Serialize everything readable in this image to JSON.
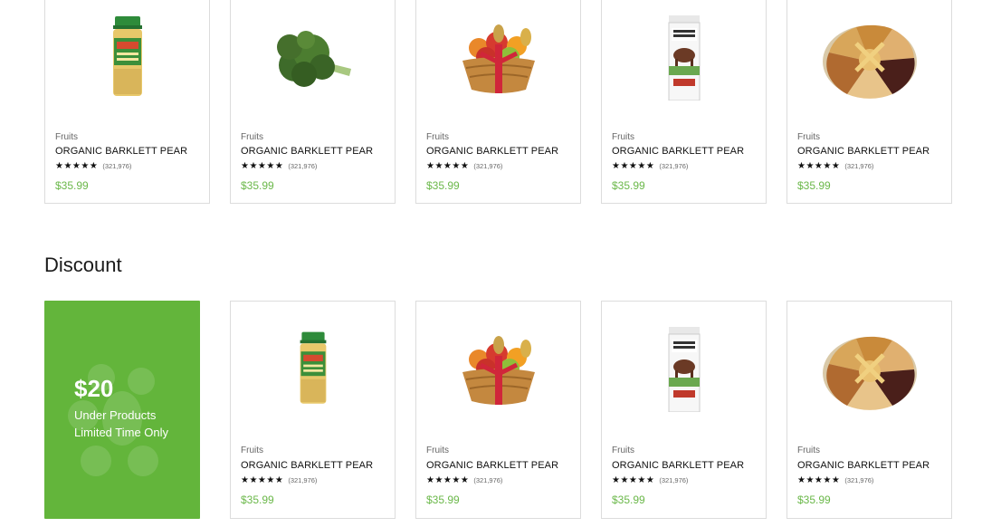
{
  "top_products": [
    {
      "category": "Fruits",
      "name": "ORGANIC BARKLETT PEAR",
      "stars": "★★★★★",
      "reviews": "(321,976)",
      "price": "$35.99",
      "image": "spice-jar"
    },
    {
      "category": "Fruits",
      "name": "ORGANIC BARKLETT PEAR",
      "stars": "★★★★★",
      "reviews": "(321,976)",
      "price": "$35.99",
      "image": "broccoli"
    },
    {
      "category": "Fruits",
      "name": "ORGANIC BARKLETT PEAR",
      "stars": "★★★★★",
      "reviews": "(321,976)",
      "price": "$35.99",
      "image": "fruit-basket"
    },
    {
      "category": "Fruits",
      "name": "ORGANIC BARKLETT PEAR",
      "stars": "★★★★★",
      "reviews": "(321,976)",
      "price": "$35.99",
      "image": "milk-carton"
    },
    {
      "category": "Fruits",
      "name": "ORGANIC BARKLETT PEAR",
      "stars": "★★★★★",
      "reviews": "(321,976)",
      "price": "$35.99",
      "image": "nut-tray"
    }
  ],
  "discount": {
    "title": "Discount",
    "promo": {
      "amount": "$20",
      "line1": "Under Products",
      "line2": "Limited Time Only",
      "color": "#63b53b"
    },
    "products": [
      {
        "category": "Fruits",
        "name": "ORGANIC BARKLETT PEAR",
        "stars": "★★★★★",
        "reviews": "(321,976)",
        "price": "$35.99",
        "image": "spice-jar"
      },
      {
        "category": "Fruits",
        "name": "ORGANIC BARKLETT PEAR",
        "stars": "★★★★★",
        "reviews": "(321,976)",
        "price": "$35.99",
        "image": "fruit-basket"
      },
      {
        "category": "Fruits",
        "name": "ORGANIC BARKLETT PEAR",
        "stars": "★★★★★",
        "reviews": "(321,976)",
        "price": "$35.99",
        "image": "milk-carton"
      },
      {
        "category": "Fruits",
        "name": "ORGANIC BARKLETT PEAR",
        "stars": "★★★★★",
        "reviews": "(321,976)",
        "price": "$35.99",
        "image": "nut-tray"
      }
    ]
  },
  "colors": {
    "price": "#6bb84a",
    "border": "#dcdcdc"
  }
}
